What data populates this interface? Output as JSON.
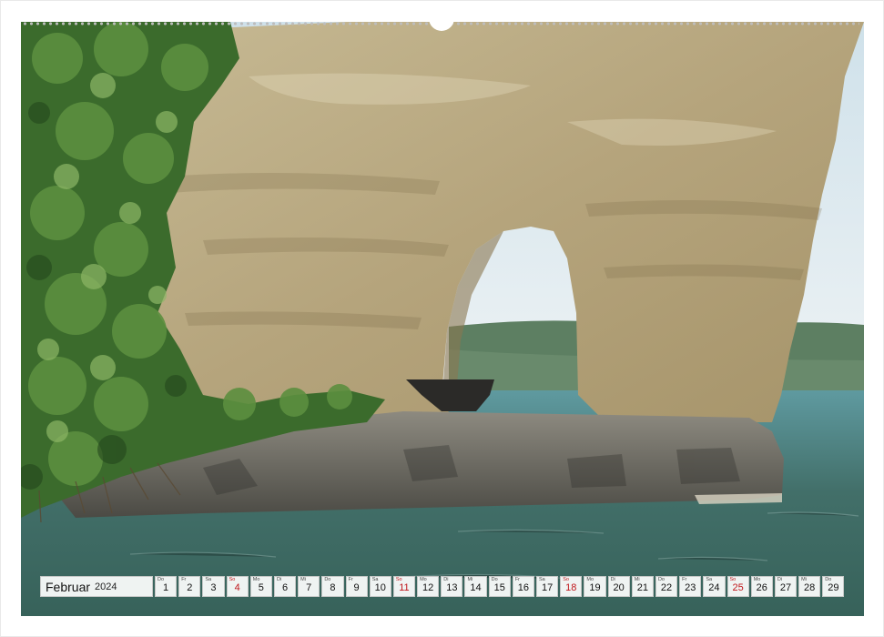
{
  "calendar": {
    "month": "Februar",
    "year": "2024",
    "days": [
      {
        "dow": "Do",
        "num": "1"
      },
      {
        "dow": "Fr",
        "num": "2"
      },
      {
        "dow": "Sa",
        "num": "3"
      },
      {
        "dow": "So",
        "num": "4",
        "sunday": true
      },
      {
        "dow": "Mo",
        "num": "5"
      },
      {
        "dow": "Di",
        "num": "6"
      },
      {
        "dow": "Mi",
        "num": "7"
      },
      {
        "dow": "Do",
        "num": "8"
      },
      {
        "dow": "Fr",
        "num": "9"
      },
      {
        "dow": "Sa",
        "num": "10"
      },
      {
        "dow": "So",
        "num": "11",
        "sunday": true
      },
      {
        "dow": "Mo",
        "num": "12"
      },
      {
        "dow": "Di",
        "num": "13"
      },
      {
        "dow": "Mi",
        "num": "14"
      },
      {
        "dow": "Do",
        "num": "15"
      },
      {
        "dow": "Fr",
        "num": "16"
      },
      {
        "dow": "Sa",
        "num": "17"
      },
      {
        "dow": "So",
        "num": "18",
        "sunday": true
      },
      {
        "dow": "Mo",
        "num": "19"
      },
      {
        "dow": "Di",
        "num": "20"
      },
      {
        "dow": "Mi",
        "num": "21"
      },
      {
        "dow": "Do",
        "num": "22"
      },
      {
        "dow": "Fr",
        "num": "23"
      },
      {
        "dow": "Sa",
        "num": "24"
      },
      {
        "dow": "So",
        "num": "25",
        "sunday": true
      },
      {
        "dow": "Mo",
        "num": "26"
      },
      {
        "dow": "Di",
        "num": "27"
      },
      {
        "dow": "Mi",
        "num": "28"
      },
      {
        "dow": "Do",
        "num": "29"
      }
    ]
  },
  "colors": {
    "sunday": "#c0161b",
    "rock": "#bcae88",
    "water": "#3f6e68",
    "sky": "#dce9f0"
  }
}
